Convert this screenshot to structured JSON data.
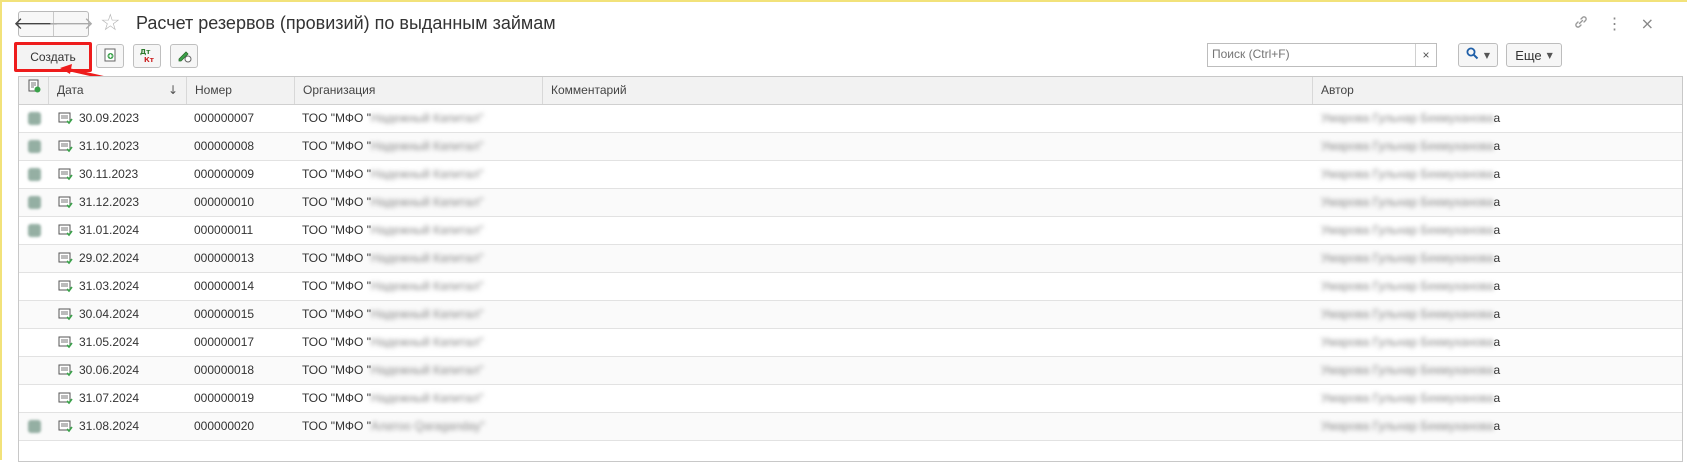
{
  "window": {
    "title": "Расчет резервов (провизий) по выданным займам"
  },
  "toolbar": {
    "create_label": "Создать",
    "search_placeholder": "Поиск (Ctrl+F)",
    "search_clear": "×",
    "more_label": "Еще"
  },
  "table": {
    "columns": {
      "date": "Дата",
      "number": "Номер",
      "organization": "Организация",
      "comment": "Комментарий",
      "author": "Автор"
    },
    "sort_indicator": "↓",
    "rows": [
      {
        "posted": true,
        "date": "30.09.2023",
        "number": "000000007",
        "org_prefix": "ТОО \"МФО \"",
        "org_blurred": "Надежный Капитал\"",
        "comment": "",
        "author_blurred": "Умарова Гульнар Бекмуханова",
        "author_suffix": "а"
      },
      {
        "posted": true,
        "date": "31.10.2023",
        "number": "000000008",
        "org_prefix": "ТОО \"МФО \"",
        "org_blurred": "Надежный Капитал\"",
        "comment": "",
        "author_blurred": "Умарова Гульнар Бекмуханова",
        "author_suffix": "а"
      },
      {
        "posted": true,
        "date": "30.11.2023",
        "number": "000000009",
        "org_prefix": "ТОО \"МФО \"",
        "org_blurred": "Надежный Капитал\"",
        "comment": "",
        "author_blurred": "Умарова Гульнар Бекмуханова",
        "author_suffix": "а"
      },
      {
        "posted": true,
        "date": "31.12.2023",
        "number": "000000010",
        "org_prefix": "ТОО \"МФО \"",
        "org_blurred": "Надежный Капитал\"",
        "comment": "",
        "author_blurred": "Умарова Гульнар Бекмуханова",
        "author_suffix": "а"
      },
      {
        "posted": true,
        "date": "31.01.2024",
        "number": "000000011",
        "org_prefix": "ТОО \"МФО \"",
        "org_blurred": "Надежный Капитал\"",
        "comment": "",
        "author_blurred": "Умарова Гульнар Бекмуханова",
        "author_suffix": "а"
      },
      {
        "posted": false,
        "date": "29.02.2024",
        "number": "000000013",
        "org_prefix": "ТОО \"МФО \"",
        "org_blurred": "Надежный Капитал\"",
        "comment": "",
        "author_blurred": "Умарова Гульнар Бекмуханова",
        "author_suffix": "а"
      },
      {
        "posted": false,
        "date": "31.03.2024",
        "number": "000000014",
        "org_prefix": "ТОО \"МФО \"",
        "org_blurred": "Надежный Капитал\"",
        "comment": "",
        "author_blurred": "Умарова Гульнар Бекмуханова",
        "author_suffix": "а"
      },
      {
        "posted": false,
        "date": "30.04.2024",
        "number": "000000015",
        "org_prefix": "ТОО \"МФО \"",
        "org_blurred": "Надежный Капитал\"",
        "comment": "",
        "author_blurred": "Умарова Гульнар Бекмуханова",
        "author_suffix": "а"
      },
      {
        "posted": false,
        "date": "31.05.2024",
        "number": "000000017",
        "org_prefix": "ТОО \"МФО \"",
        "org_blurred": "Надежный Капитал\"",
        "comment": "",
        "author_blurred": "Умарова Гульнар Бекмуханова",
        "author_suffix": "а"
      },
      {
        "posted": false,
        "date": "30.06.2024",
        "number": "000000018",
        "org_prefix": "ТОО \"МФО \"",
        "org_blurred": "Надежный Капитал\"",
        "comment": "",
        "author_blurred": "Умарова Гульнар Бекмуханова",
        "author_suffix": "а"
      },
      {
        "posted": false,
        "date": "31.07.2024",
        "number": "000000019",
        "org_prefix": "ТОО \"МФО \"",
        "org_blurred": "Надежный Капитал\"",
        "comment": "",
        "author_blurred": "Умарова Гульнар Бекмуханова",
        "author_suffix": "а"
      },
      {
        "posted": true,
        "date": "31.08.2024",
        "number": "000000020",
        "org_prefix": "ТОО \"МФО \"",
        "org_blurred": "Алатоо Qaraganday\"",
        "comment": "",
        "author_blurred": "Умарова Гульнар Бекмуханова",
        "author_suffix": "а"
      }
    ]
  },
  "colors": {
    "highlight_red": "#ee1c1c",
    "frame_yellow": "#f2e27a",
    "doc_icon_green": "#3aa24a"
  },
  "icons": {
    "back": "arrow-left-icon",
    "forward": "arrow-right-icon",
    "favorite": "star-icon",
    "link": "link-icon",
    "menu": "kebab-menu-icon",
    "copy": "copy-document-icon",
    "dt_kt": "dt-kt-postings-icon",
    "edit": "edit-pen-icon",
    "search": "magnifier-icon"
  }
}
